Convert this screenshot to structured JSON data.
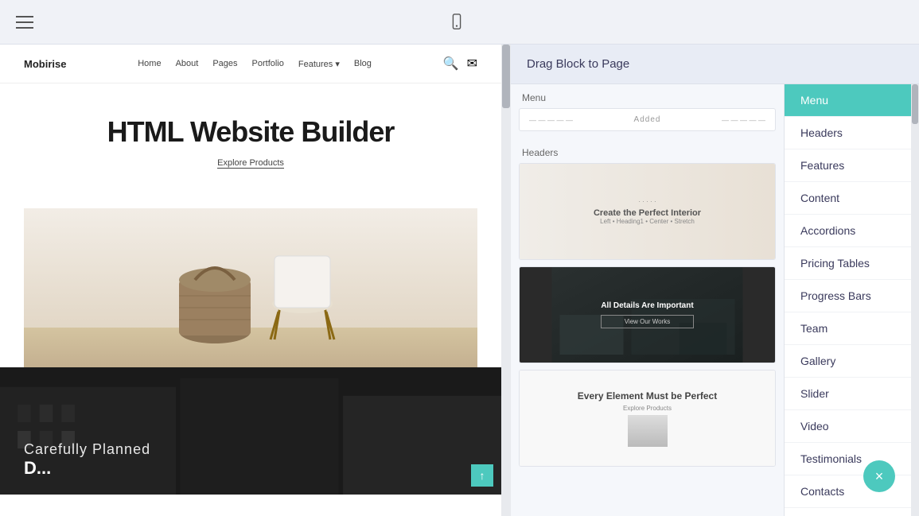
{
  "topbar": {
    "title": "Drag Block to Page"
  },
  "preview": {
    "site_logo": "Mobirise",
    "nav_links": [
      "Home",
      "About",
      "Pages",
      "Portfolio",
      "Features ▾",
      "Blog"
    ],
    "hero_title": "HTML Website Builder",
    "hero_link": "Explore Products",
    "carefully_title": "Carefully Planned",
    "carefully_sub": "D..."
  },
  "block_panel": {
    "header": "Drag Block to Page",
    "sections": [
      {
        "label": "Menu",
        "type": "menu",
        "added_text": "Added"
      },
      {
        "label": "Headers",
        "type": "headers"
      }
    ]
  },
  "categories": [
    {
      "id": "menu",
      "label": "Menu",
      "active": true
    },
    {
      "id": "headers",
      "label": "Headers",
      "active": false
    },
    {
      "id": "features",
      "label": "Features",
      "active": false
    },
    {
      "id": "content",
      "label": "Content",
      "active": false
    },
    {
      "id": "accordions",
      "label": "Accordions",
      "active": false
    },
    {
      "id": "pricing-tables",
      "label": "Pricing Tables",
      "active": false
    },
    {
      "id": "progress-bars",
      "label": "Progress Bars",
      "active": false
    },
    {
      "id": "team",
      "label": "Team",
      "active": false
    },
    {
      "id": "gallery",
      "label": "Gallery",
      "active": false
    },
    {
      "id": "slider",
      "label": "Slider",
      "active": false
    },
    {
      "id": "video",
      "label": "Video",
      "active": false
    },
    {
      "id": "testimonials",
      "label": "Testimonials",
      "active": false
    },
    {
      "id": "contacts",
      "label": "Contacts",
      "active": false
    }
  ],
  "close_btn_label": "×",
  "scroll_up_label": "↑",
  "menu_added": "Added",
  "thumb1_title": "Create the Perfect Interior",
  "thumb1_sub": "Left • Heading1 • Center • Stretch",
  "thumb2_overlay": "All Details Are Important",
  "thumb2_btn": "View Our Works",
  "thumb3_title": "Every Element Must be Perfect",
  "thumb3_sub": "Explore Products"
}
